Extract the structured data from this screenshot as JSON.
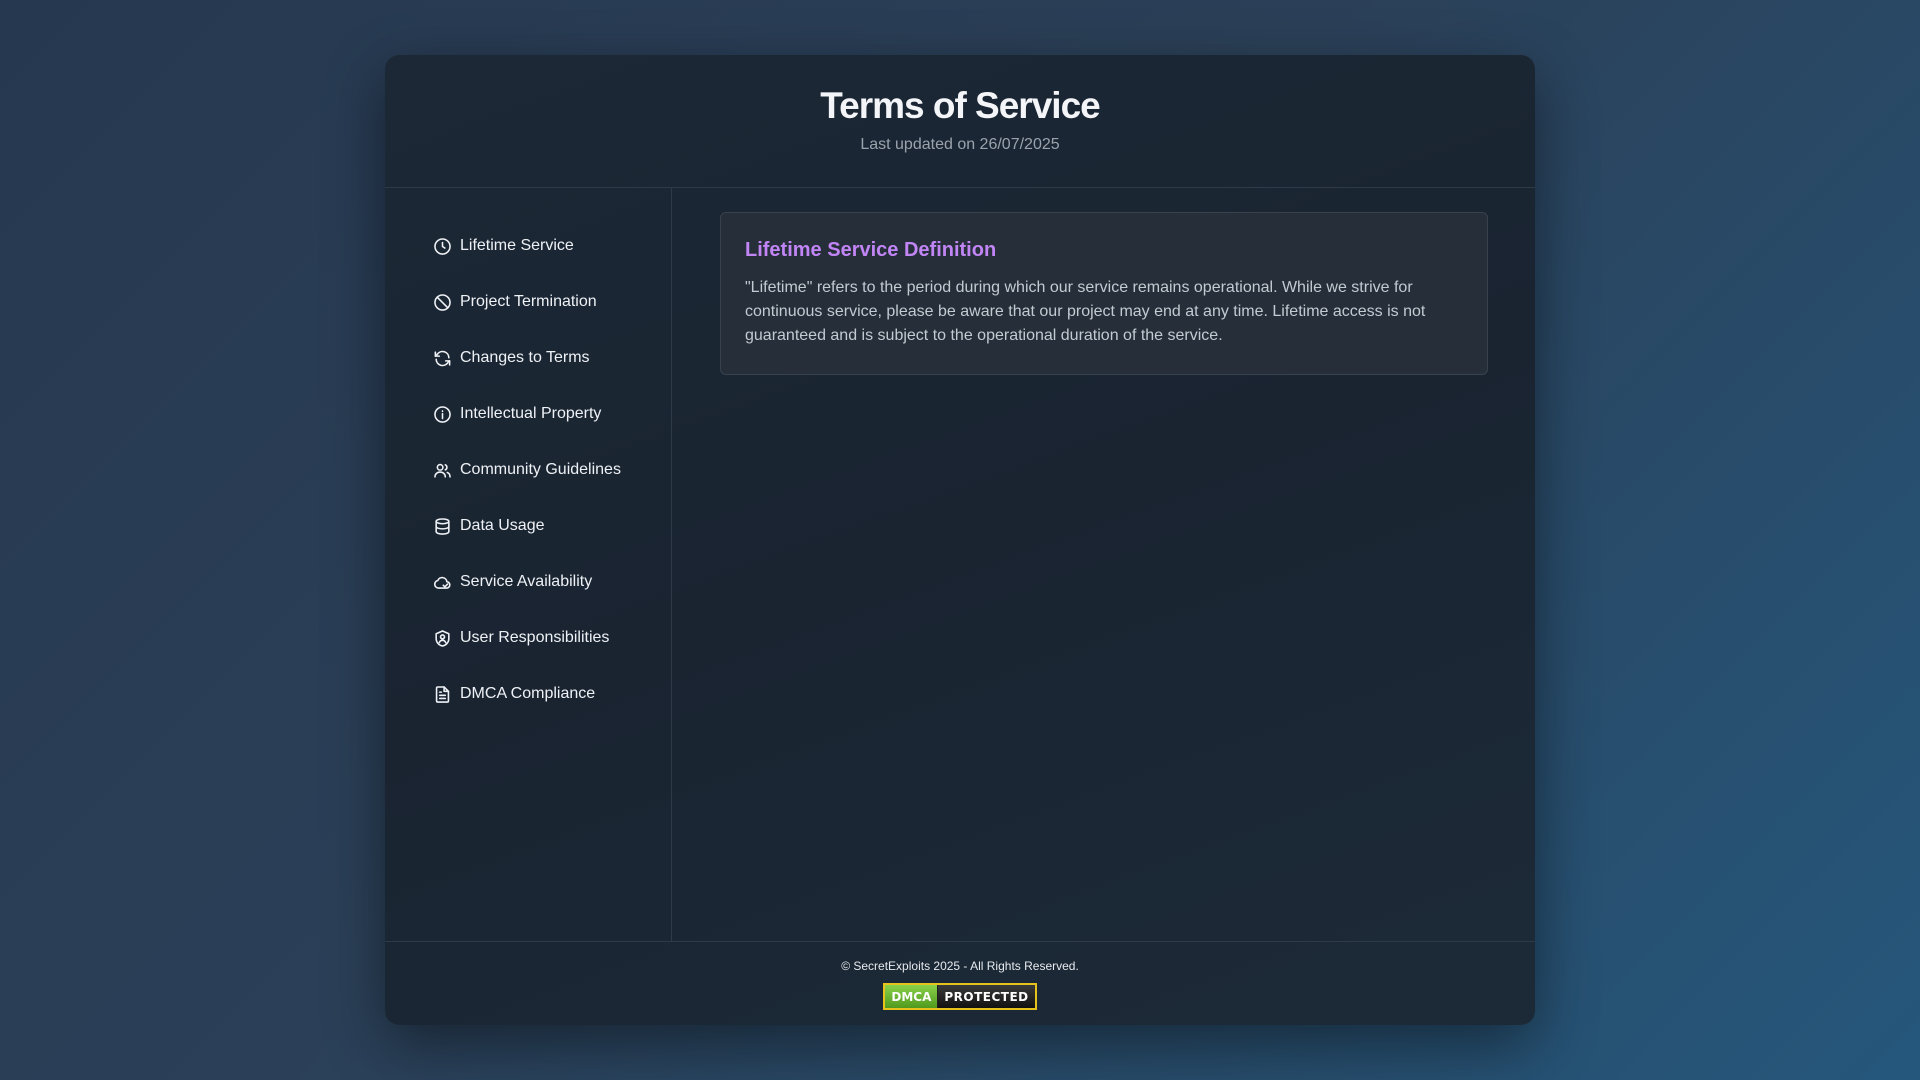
{
  "header": {
    "title": "Terms of Service",
    "subtitle": "Last updated on 26/07/2025"
  },
  "sidebar": {
    "items": [
      {
        "label": "Lifetime Service",
        "icon": "clock-icon"
      },
      {
        "label": "Project Termination",
        "icon": "ban-icon"
      },
      {
        "label": "Changes to Terms",
        "icon": "refresh-icon"
      },
      {
        "label": "Intellectual Property",
        "icon": "info-icon"
      },
      {
        "label": "Community Guidelines",
        "icon": "users-icon"
      },
      {
        "label": "Data Usage",
        "icon": "database-icon"
      },
      {
        "label": "Service Availability",
        "icon": "cloud-icon"
      },
      {
        "label": "User Responsibilities",
        "icon": "shield-user-icon"
      },
      {
        "label": "DMCA Compliance",
        "icon": "document-icon"
      }
    ]
  },
  "content": {
    "card_title": "Lifetime Service Definition",
    "card_text": "\"Lifetime\" refers to the period during which our service remains operational. While we strive for continuous service, please be aware that our project may end at any time. Lifetime access is not guaranteed and is subject to the operational duration of the service."
  },
  "footer": {
    "copyright": "© SecretExploits 2025 - All Rights Reserved.",
    "badge_left": "DMCA",
    "badge_right": "PROTECTED"
  },
  "colors": {
    "accent": "#c285f5",
    "badge_border": "#e6c21a"
  }
}
